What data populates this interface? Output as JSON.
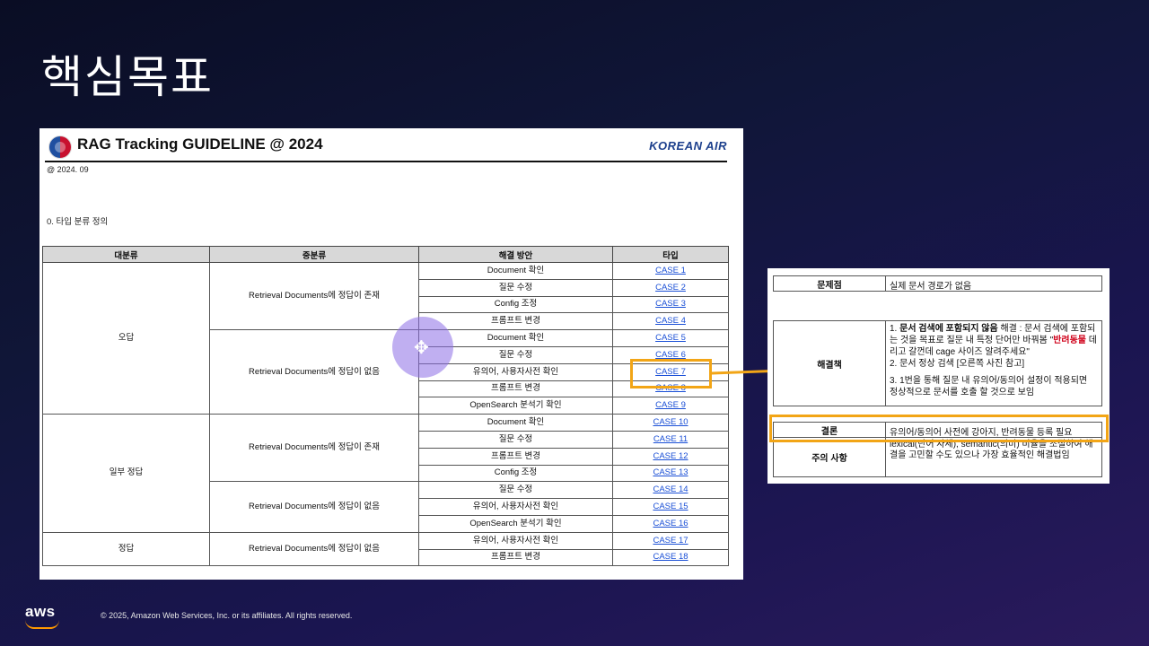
{
  "slide": {
    "title": "핵심목표",
    "copyright": "© 2025, Amazon Web Services, Inc. or its affiliates. All rights reserved.",
    "aws_logo_text": "aws"
  },
  "doc": {
    "title": "RAG Tracking GUIDELINE @ 2024",
    "brand": "KOREAN AIR",
    "date": "@ 2024. 09",
    "section": "0. 타입 분류 정의",
    "headers": [
      "대분류",
      "중분류",
      "해결 방안",
      "타입"
    ],
    "groups": {
      "wrong": "오답",
      "partial": "일부 정답",
      "correct": "정답"
    },
    "sub": {
      "exists": "Retrieval Documents에 정답이 존재",
      "missing": "Retrieval Documents에 정답이 없음"
    },
    "rows": [
      {
        "action": "Document 확인",
        "case": "CASE 1"
      },
      {
        "action": "질문 수정",
        "case": "CASE 2"
      },
      {
        "action": "Config 조정",
        "case": "CASE 3"
      },
      {
        "action": "프롬프트 변경",
        "case": "CASE 4"
      },
      {
        "action": "Document 확인",
        "case": "CASE 5"
      },
      {
        "action": "질문 수정",
        "case": "CASE 6"
      },
      {
        "action": "유의어, 사용자사전 확인",
        "case": "CASE 7"
      },
      {
        "action": "프롬프트 변경",
        "case": "CASE 8"
      },
      {
        "action": "OpenSearch 분석기 확인",
        "case": "CASE 9"
      },
      {
        "action": "Document 확인",
        "case": "CASE 10"
      },
      {
        "action": "질문 수정",
        "case": "CASE 11"
      },
      {
        "action": "프롬프트 변경",
        "case": "CASE 12"
      },
      {
        "action": "Config 조정",
        "case": "CASE 13"
      },
      {
        "action": "질문 수정",
        "case": "CASE 14"
      },
      {
        "action": "유의어, 사용자사전 확인",
        "case": "CASE 15"
      },
      {
        "action": "OpenSearch 분석기 확인",
        "case": "CASE 16"
      },
      {
        "action": "유의어, 사용자사전 확인",
        "case": "CASE 17"
      },
      {
        "action": "프롬프트 변경",
        "case": "CASE 18"
      }
    ]
  },
  "detail": {
    "problem_label": "문제점",
    "problem_value": "실제 문서 경로가 없음",
    "solution_label": "해결책",
    "solution_1a": "1. ",
    "solution_1b": "문서 검색에 포함되지 않음",
    "solution_1c": " 해결 : 문서 검색에 포함되는 것을 목표로 질문 내 특정 단어만 바꿔봄 \"",
    "solution_1d": "반려동물",
    "solution_1e": " 데리고 갈껀데 cage 사이즈 알려주세요\"",
    "solution_2": "2. 문서 정상 검색 [오른쪽 사진 참고]",
    "solution_3": "3. 1번을 통해 질문 내 유의어/동의어 설정이 적용되면 정상적으로 문서를 호출 할 것으로 보임",
    "conclusion_label": "결론",
    "conclusion_value": "유의어/동의어 사전에 강아지, 반려동물 등록 필요",
    "caution_label": "주의 사항",
    "caution_value": "lexical(단어 자체), semantic(의미) 비율을 조절하여 해결을 고민할 수도 있으나 가장 효율적인 해결법임"
  },
  "colors": {
    "highlight": "#f2a516",
    "link": "#1a4fd6",
    "emphasis": "#d0021b"
  }
}
